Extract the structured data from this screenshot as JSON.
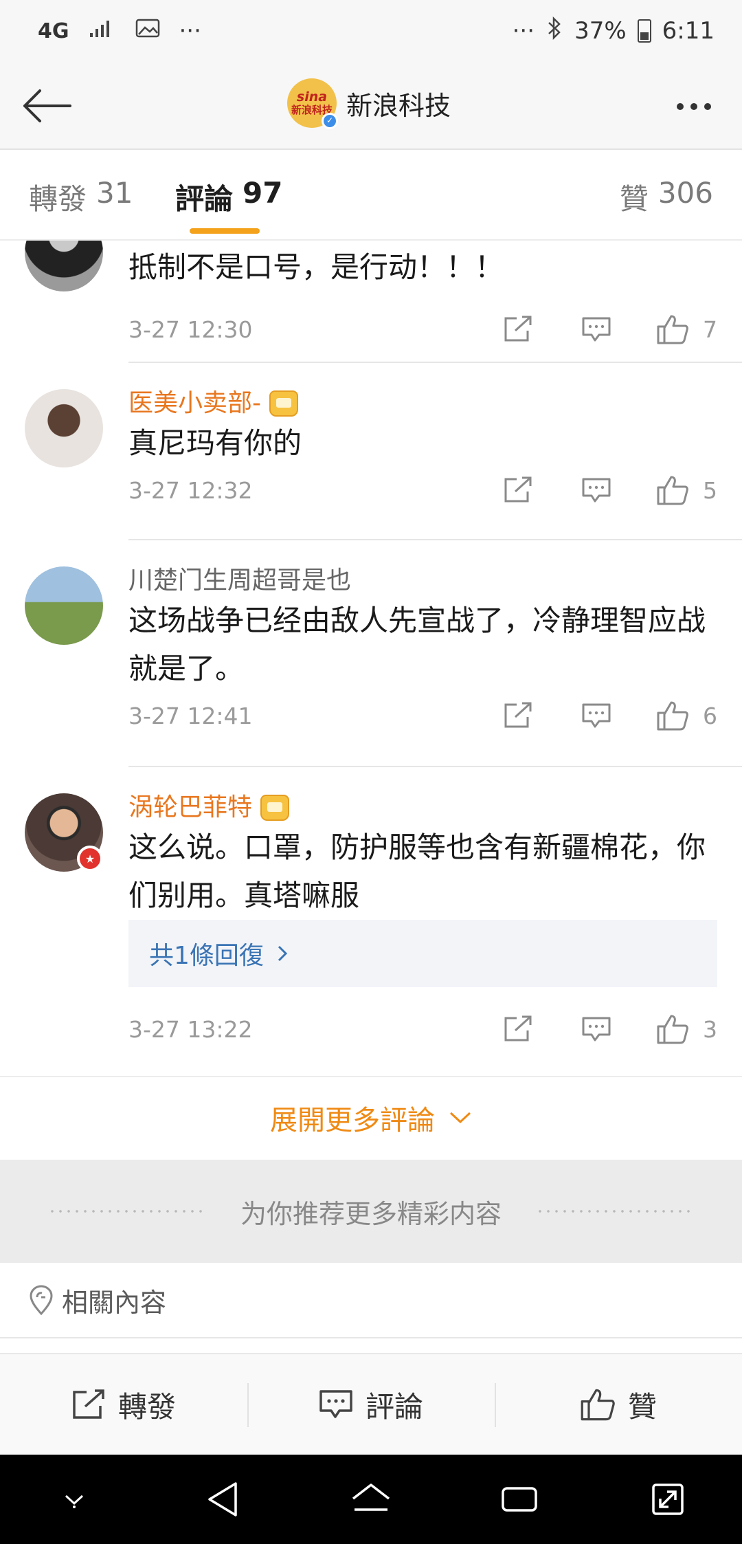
{
  "status_bar": {
    "network": "4G",
    "left_more": "···",
    "right_more": "···",
    "battery": "37%",
    "time": "6:11"
  },
  "header": {
    "title": "新浪科技",
    "logo_text_top": "sina",
    "logo_text_bottom": "新浪科技"
  },
  "tabs": [
    {
      "label": "轉發",
      "count": "31"
    },
    {
      "label": "評論",
      "count": "97"
    },
    {
      "label": "贊",
      "count": "306"
    }
  ],
  "comments": [
    {
      "name": "",
      "text": "抵制不是口号，是行动！！！",
      "time": "3-27 12:30",
      "likes": "7"
    },
    {
      "name": "医美小卖部-",
      "text": "真尼玛有你的",
      "time": "3-27 12:32",
      "likes": "5"
    },
    {
      "name": "川楚门生周超哥是也",
      "text": "这场战争已经由敌人先宣战了，冷静理智应战就是了。",
      "time": "3-27 12:41",
      "likes": "6"
    },
    {
      "name": "涡轮巴菲特",
      "text": "这么说。口罩，防护服等也含有新疆棉花，你们别用。真塔嘛服",
      "time": "3-27 13:22",
      "likes": "3",
      "reply_summary": "共1條回復"
    }
  ],
  "expand_more": "展開更多評論",
  "recommend": "为你推荐更多精彩内容",
  "related": "相關內容",
  "toolbar": {
    "forward": "轉發",
    "comment": "評論",
    "like": "贊"
  },
  "colors": {
    "accent": "#f4a21c",
    "vip_name": "#e8771f",
    "reply_link": "#3a74b4"
  }
}
